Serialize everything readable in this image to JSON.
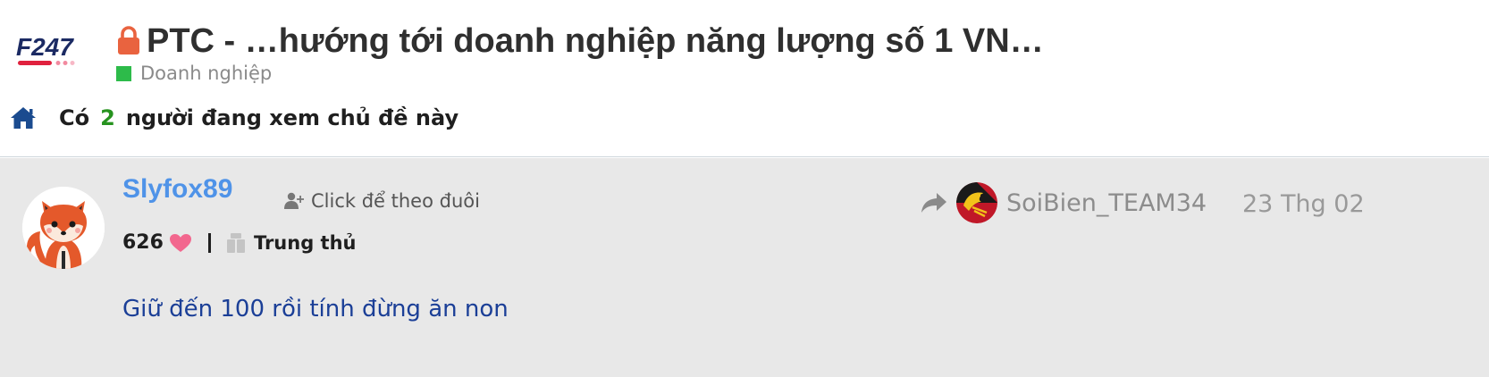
{
  "header": {
    "logo_text": "F247",
    "title": "PTC - …hướng tới doanh nghiệp năng lượng số 1 VN…",
    "category": "Doanh nghiệp",
    "category_color": "#2dbb4a",
    "viewers_prefix": "Có",
    "viewers_count": "2",
    "viewers_suffix": "người đang xem chủ đề này"
  },
  "post": {
    "author": "Slyfox89",
    "follow_label": "Click để theo đuôi",
    "likes": "626",
    "rank": "Trung thủ",
    "reply_to_user": "SoiBien_TEAM34",
    "date": "23 Thg 02",
    "message": "Giữ đến 100 rồi tính đừng ăn non"
  },
  "icons": {
    "lock": "lock-icon",
    "home": "home-icon",
    "follow": "user-plus-icon",
    "heart": "heart-icon",
    "rank": "badge-icon",
    "share": "share-arrow-icon"
  },
  "colors": {
    "author": "#4f93e8",
    "message": "#1b3f97",
    "heart": "#f2678e",
    "lock": "#e9633f"
  }
}
